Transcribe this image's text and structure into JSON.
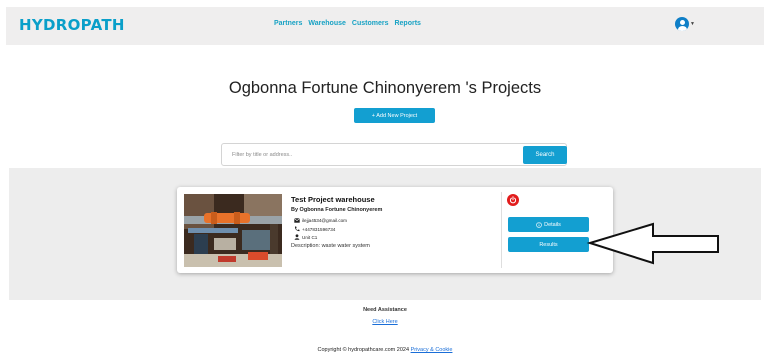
{
  "header": {
    "brand": "HYDROPATH",
    "nav": [
      "Partners",
      "Warehouse",
      "Customers",
      "Reports"
    ],
    "user_icon": "user-circle-icon"
  },
  "main": {
    "title": "Ogbonna Fortune Chinonyerem 's Projects",
    "add_button": "+ Add New Project",
    "search": {
      "placeholder": "Filter by title or address..",
      "value": "",
      "button": "Search"
    }
  },
  "project": {
    "title": "Test Project warehouse",
    "owner": "By Ogbonna Fortune Chinonyerem",
    "email": "ilejja4534@gmail.com",
    "phone": "+447831596734",
    "unit": "Unit C1",
    "description": "Description: waste water system",
    "details_button": "Details",
    "results_button": "Results",
    "power_color": "#e21c1c"
  },
  "footer": {
    "assist_title": "Need Assistance",
    "assist_link": "Click Here",
    "copyright": "Copyright © hydropathcare.com 2024",
    "privacy": "Privacy & Cookie"
  },
  "colors": {
    "brand": "#0a9fc9",
    "accent": "#139fd1",
    "nav_background": "#efeeee",
    "band_background": "#ededed",
    "link": "#1a6ed8"
  }
}
